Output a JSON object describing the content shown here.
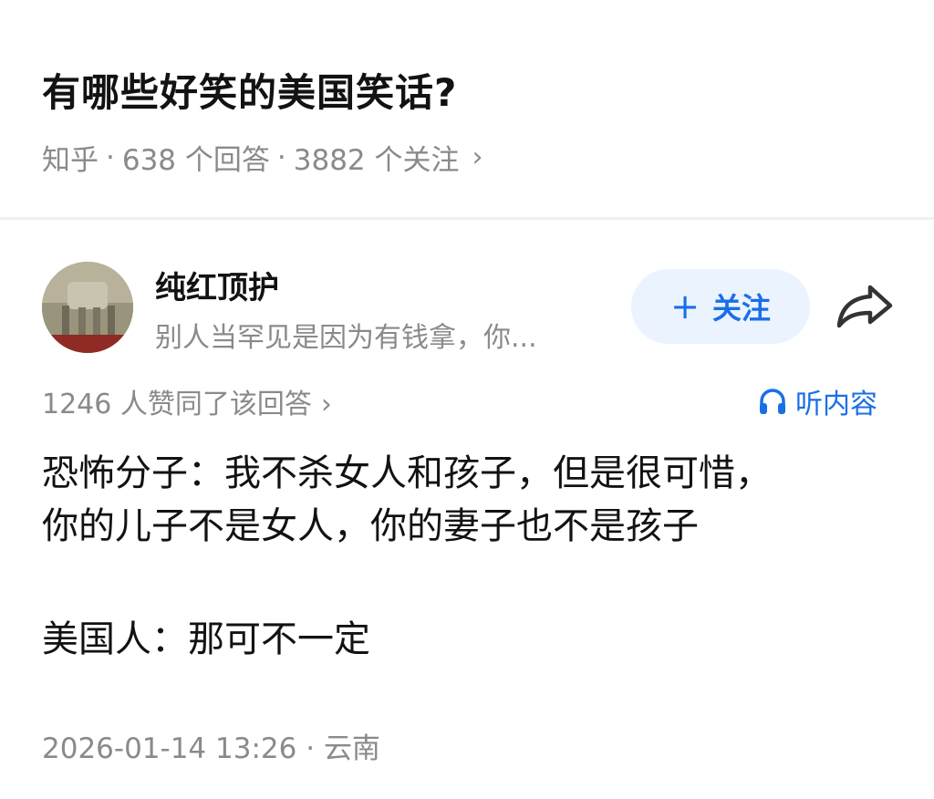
{
  "question": {
    "title": "有哪些好笑的美国笑话?",
    "source": "知乎",
    "answers": "638 个回答",
    "followers": "3882 个关注",
    "separator": "·",
    "chevron": "›"
  },
  "author": {
    "name": "纯红顶护",
    "bio": "别人当罕见是因为有钱拿，你...",
    "follow_label": "关注",
    "follow_plus": "+",
    "share_icon": "share-icon"
  },
  "answer_meta": {
    "votes": "1246 人赞同了该回答",
    "chevron": "›",
    "listen_label": "听内容",
    "listen_icon": "headphones-icon"
  },
  "answer": {
    "line1": "恐怖分子：我不杀女人和孩子，但是很可惜，",
    "line2": "你的儿子不是女人，你的妻子也不是孩子",
    "line3": "美国人：那可不一定"
  },
  "footer": {
    "timestamp": "2026-01-14 13:26",
    "separator": "·",
    "location": "云南"
  },
  "colors": {
    "accent": "#1a6fe6",
    "follow_bg": "#ebf3fe",
    "meta_gray": "#8a8a8a",
    "title": "#121212"
  }
}
